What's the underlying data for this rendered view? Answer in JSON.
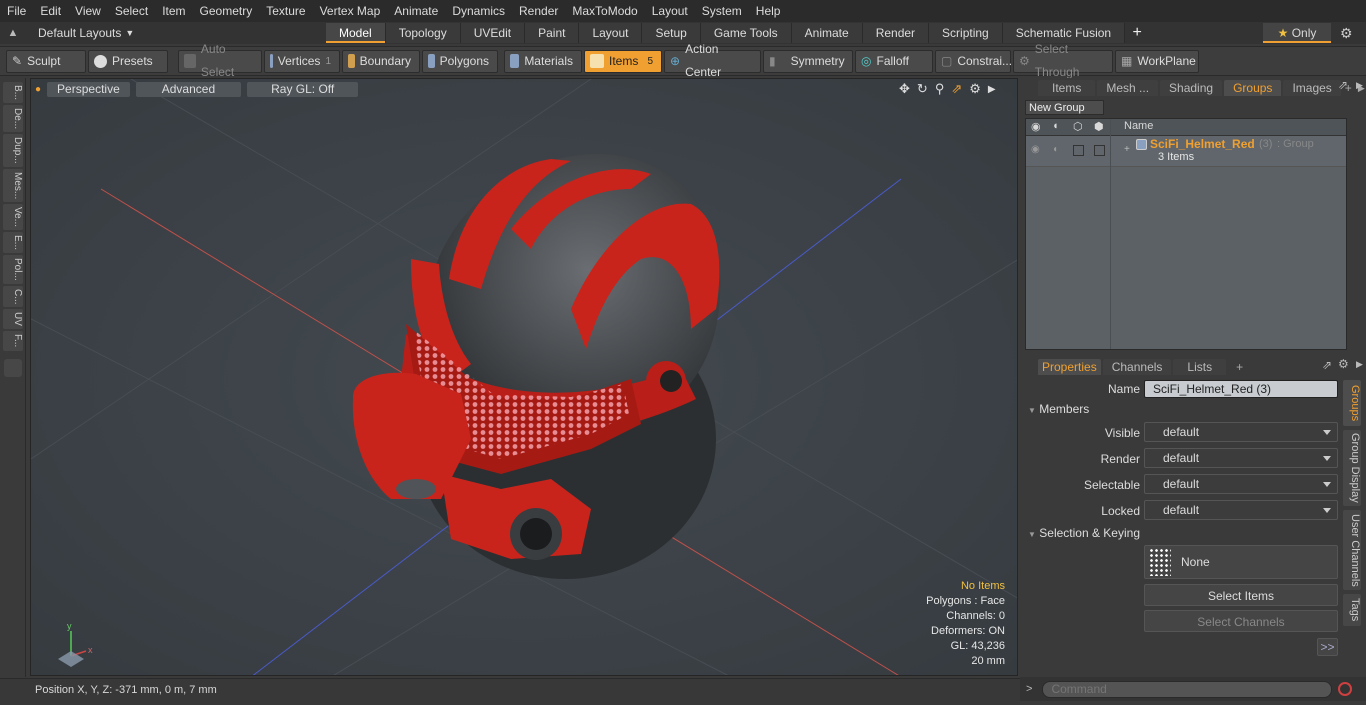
{
  "menu": [
    "File",
    "Edit",
    "View",
    "Select",
    "Item",
    "Geometry",
    "Texture",
    "Vertex Map",
    "Animate",
    "Dynamics",
    "Render",
    "MaxToModo",
    "Layout",
    "System",
    "Help"
  ],
  "layouts_label": "Default Layouts",
  "mode_tabs": [
    "Model",
    "Topology",
    "UVEdit",
    "Paint",
    "Layout",
    "Setup",
    "Game Tools",
    "Animate",
    "Render",
    "Scripting",
    "Schematic Fusion"
  ],
  "only_label": "Only",
  "toolbar": {
    "sculpt": "Sculpt",
    "presets": "Presets",
    "auto_select": "Auto Select",
    "vertices": "Vertices",
    "vertices_count": "1",
    "boundary": "Boundary",
    "polygons": "Polygons",
    "materials": "Materials",
    "items": "Items",
    "items_count": "5",
    "action_center": "Action Center",
    "symmetry": "Symmetry",
    "falloff": "Falloff",
    "constraints": "Constrai...",
    "select_through": "Select Through",
    "workplane": "WorkPlane"
  },
  "left_tabs": [
    "B...",
    "De...",
    "Dup...",
    "Mes...",
    "Ve...",
    "E...",
    "Pol...",
    "C...",
    "UV",
    "F..."
  ],
  "viewport": {
    "view": "Perspective",
    "shading": "Advanced",
    "raygl": "Ray GL: Off"
  },
  "stats": {
    "items": "No Items",
    "polygons": "Polygons : Face",
    "channels": "Channels: 0",
    "deformers": "Deformers: ON",
    "gl": "GL: 43,236",
    "scale": "20 mm"
  },
  "status_position": "Position X, Y, Z:   -371 mm, 0 m, 7 mm",
  "top_tabs": [
    "Items",
    "Mesh ...",
    "Shading",
    "Groups",
    "Images"
  ],
  "new_group": "New Group",
  "group_header": "Name",
  "group": {
    "name": "SciFi_Helmet_Red",
    "count": "(3)",
    "type": ": Group",
    "items": "3 Items"
  },
  "prop_tabs": [
    "Properties",
    "Channels",
    "Lists"
  ],
  "props": {
    "name_label": "Name",
    "name_value": "SciFi_Helmet_Red (3)",
    "members": "Members",
    "visible_label": "Visible",
    "visible": "default",
    "render_label": "Render",
    "render": "default",
    "selectable_label": "Selectable",
    "selectable": "default",
    "locked_label": "Locked",
    "locked": "default",
    "selection_keying": "Selection & Keying",
    "none": "None",
    "select_items": "Select Items",
    "select_channels": "Select Channels",
    "more": ">>"
  },
  "side_tabs": [
    "Groups",
    "Group Display",
    "User Channels",
    "Tags"
  ],
  "command_placeholder": "Command",
  "colors": {
    "accent": "#f0a030",
    "helmet_red": "#c8241c",
    "viewport_bg": "#3c4146"
  }
}
